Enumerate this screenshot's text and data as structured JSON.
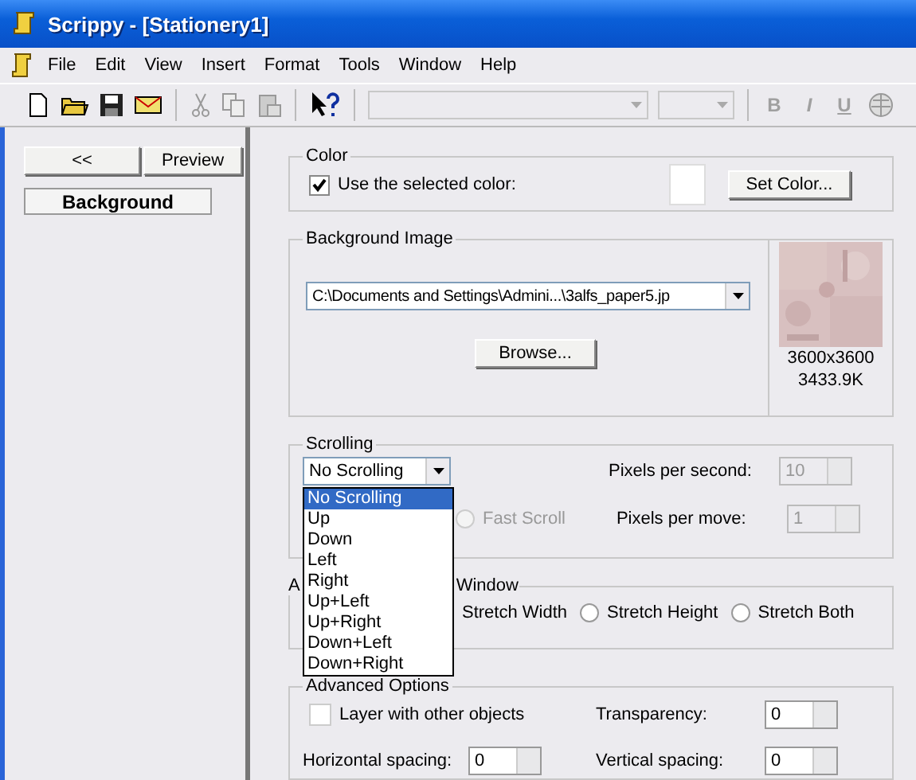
{
  "window": {
    "title": "Scrippy - [Stationery1]"
  },
  "menu": [
    "File",
    "Edit",
    "View",
    "Insert",
    "Format",
    "Tools",
    "Window",
    "Help"
  ],
  "toolbar": {
    "format_buttons": [
      {
        "label": "B",
        "disabled": true
      },
      {
        "label": "I",
        "disabled": true
      },
      {
        "label": "U",
        "disabled": true
      }
    ]
  },
  "sidebar": {
    "buttons": [
      "<<",
      "Preview"
    ],
    "items": [
      {
        "label": "Background",
        "selected": true
      }
    ]
  },
  "color": {
    "title": "Color",
    "checkbox": {
      "label": "Use the selected color:",
      "checked": true
    },
    "button": "Set Color..."
  },
  "background_image": {
    "title": "Background Image",
    "path": "C:\\Documents and Settings\\Admini...\\3alfs_paper5.jp",
    "button": "Browse...",
    "dimensions": "3600x3600",
    "size": "3433.9K"
  },
  "scrolling": {
    "title": "Scrolling",
    "mode": "No Scrolling",
    "options": [
      {
        "label": "No Scrolling",
        "selected": true
      },
      {
        "label": "Up",
        "selected": false
      },
      {
        "label": "Down",
        "selected": false
      },
      {
        "label": "Left",
        "selected": false
      },
      {
        "label": "Right",
        "selected": false
      },
      {
        "label": "Up+Left",
        "selected": false
      },
      {
        "label": "Up+Right",
        "selected": false
      },
      {
        "label": "Down+Left",
        "selected": false
      },
      {
        "label": "Down+Right",
        "selected": false
      }
    ],
    "fast_scroll": {
      "label": "Fast Scroll",
      "disabled": true
    },
    "fields": [
      {
        "label": "Pixels per second:",
        "value": "10",
        "disabled": true
      },
      {
        "label": "Pixels per move:",
        "value": "1",
        "disabled": true
      }
    ]
  },
  "window_fit": {
    "title_parts": [
      "A",
      "Window"
    ],
    "options": [
      {
        "label": "Stretch Width"
      },
      {
        "label": "Stretch Height",
        "selected": false
      },
      {
        "label": "Stretch Both",
        "selected": false
      }
    ]
  },
  "advanced": {
    "title": "Advanced Options",
    "checkbox": {
      "label": "Layer with other objects",
      "checked": false
    },
    "fields": [
      {
        "label": "Transparency:",
        "value": "0"
      },
      {
        "label": "Horizontal spacing:",
        "value": "0"
      },
      {
        "label": "Vertical spacing:",
        "value": "0"
      }
    ]
  }
}
